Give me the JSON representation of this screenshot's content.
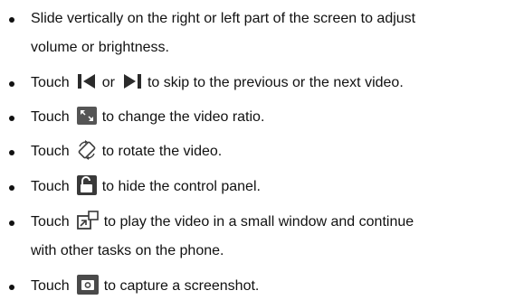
{
  "items": [
    {
      "line1": "Slide vertically on the right or left part of the screen to adjust",
      "line2": "volume or brightness."
    },
    {
      "prefix": "Touch",
      "icon1": "skip-previous-icon",
      "middle": "or",
      "icon2": "skip-next-icon",
      "suffix": "to skip to the previous or the next video."
    },
    {
      "prefix": "Touch",
      "icon": "aspect-ratio-icon",
      "suffix": "to change the video ratio."
    },
    {
      "prefix": "Touch",
      "icon": "rotate-icon",
      "suffix": "to rotate the video."
    },
    {
      "prefix": "Touch",
      "icon": "unlock-icon",
      "suffix": "to hide the control panel."
    },
    {
      "prefix": "Touch",
      "icon": "picture-in-picture-icon",
      "suffix": "to play the video in a small window and continue",
      "line2": "with other tasks on the phone."
    },
    {
      "prefix": "Touch",
      "icon": "camera-icon",
      "suffix": "to capture a screenshot."
    }
  ],
  "colors": {
    "text": "#111111",
    "icon_dark": "#2b2b2b",
    "icon_gray": "#555555"
  }
}
